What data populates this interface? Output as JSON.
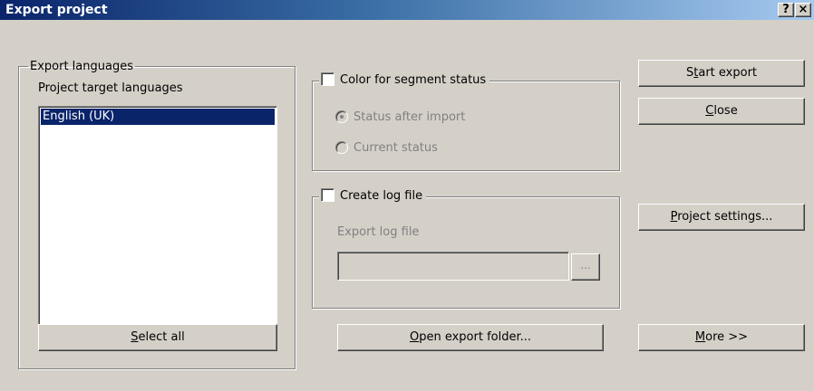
{
  "window": {
    "title": "Export project",
    "help_label": "?",
    "close_label": "×"
  },
  "languages_group": {
    "legend": "Export languages",
    "list_label": "Project target languages",
    "items": [
      "English (UK)"
    ],
    "select_all": {
      "before": "",
      "mnemonic": "S",
      "after": "elect all"
    }
  },
  "segment_group": {
    "checkbox_label": "Color for segment status",
    "checked": false,
    "radio_options": [
      "Status after import",
      "Current status"
    ],
    "selected_radio": "Status after import"
  },
  "log_group": {
    "checkbox_label": "Create log file",
    "checked": false,
    "field_label": "Export log file",
    "field_value": "",
    "browse_label": "..."
  },
  "buttons": {
    "start_export": {
      "before": "S",
      "mnemonic": "t",
      "after": "art export"
    },
    "close": {
      "before": "",
      "mnemonic": "C",
      "after": "lose"
    },
    "project_settings": {
      "before": "",
      "mnemonic": "P",
      "after": "roject settings..."
    },
    "open_export_folder": {
      "before": "",
      "mnemonic": "O",
      "after": "pen export folder..."
    },
    "more": {
      "before": "",
      "mnemonic": "M",
      "after": "ore >>"
    }
  }
}
